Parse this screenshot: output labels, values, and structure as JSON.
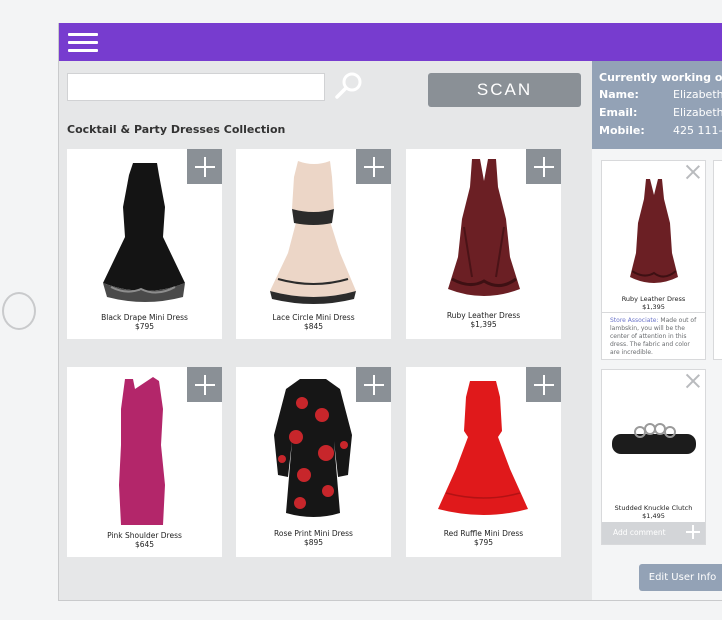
{
  "search": {
    "placeholder": ""
  },
  "scan_label": "SCAN",
  "collection_title": "Cocktail & Party Dresses Collection",
  "products": [
    {
      "name": "Black Drape Mini Dress",
      "price": "$795"
    },
    {
      "name": "Lace Circle Mini Dress",
      "price": "$845"
    },
    {
      "name": "Ruby Leather Dress",
      "price": "$1,395"
    },
    {
      "name": "Pink Shoulder Dress",
      "price": "$645"
    },
    {
      "name": "Rose Print Mini Dress",
      "price": "$895"
    },
    {
      "name": "Red Ruffle Mini Dress",
      "price": "$795"
    }
  ],
  "client": {
    "heading": "Currently working on",
    "name_label": "Name:",
    "name_value": "Elizabeth",
    "email_label": "Email:",
    "email_value": "Elizabeth",
    "mobile_label": "Mobile:",
    "mobile_value": "425 111-"
  },
  "wishlist": [
    {
      "name": "Ruby Leather Dress",
      "price": "$1,395",
      "note_label": "Store Associate:",
      "note_text": " Made out of lambskin, you will be the center of attention in this dress. The fabric and color are incredible."
    },
    {
      "name": "Studded Knuckle Clutch",
      "price": "$1,495",
      "add_comment_label": "Add comment"
    }
  ],
  "edit_user_label": "Edit User Info",
  "colors": {
    "accent_purple": "#773ccf",
    "button_gray": "#8a9096",
    "client_blue": "#93a2b6"
  }
}
